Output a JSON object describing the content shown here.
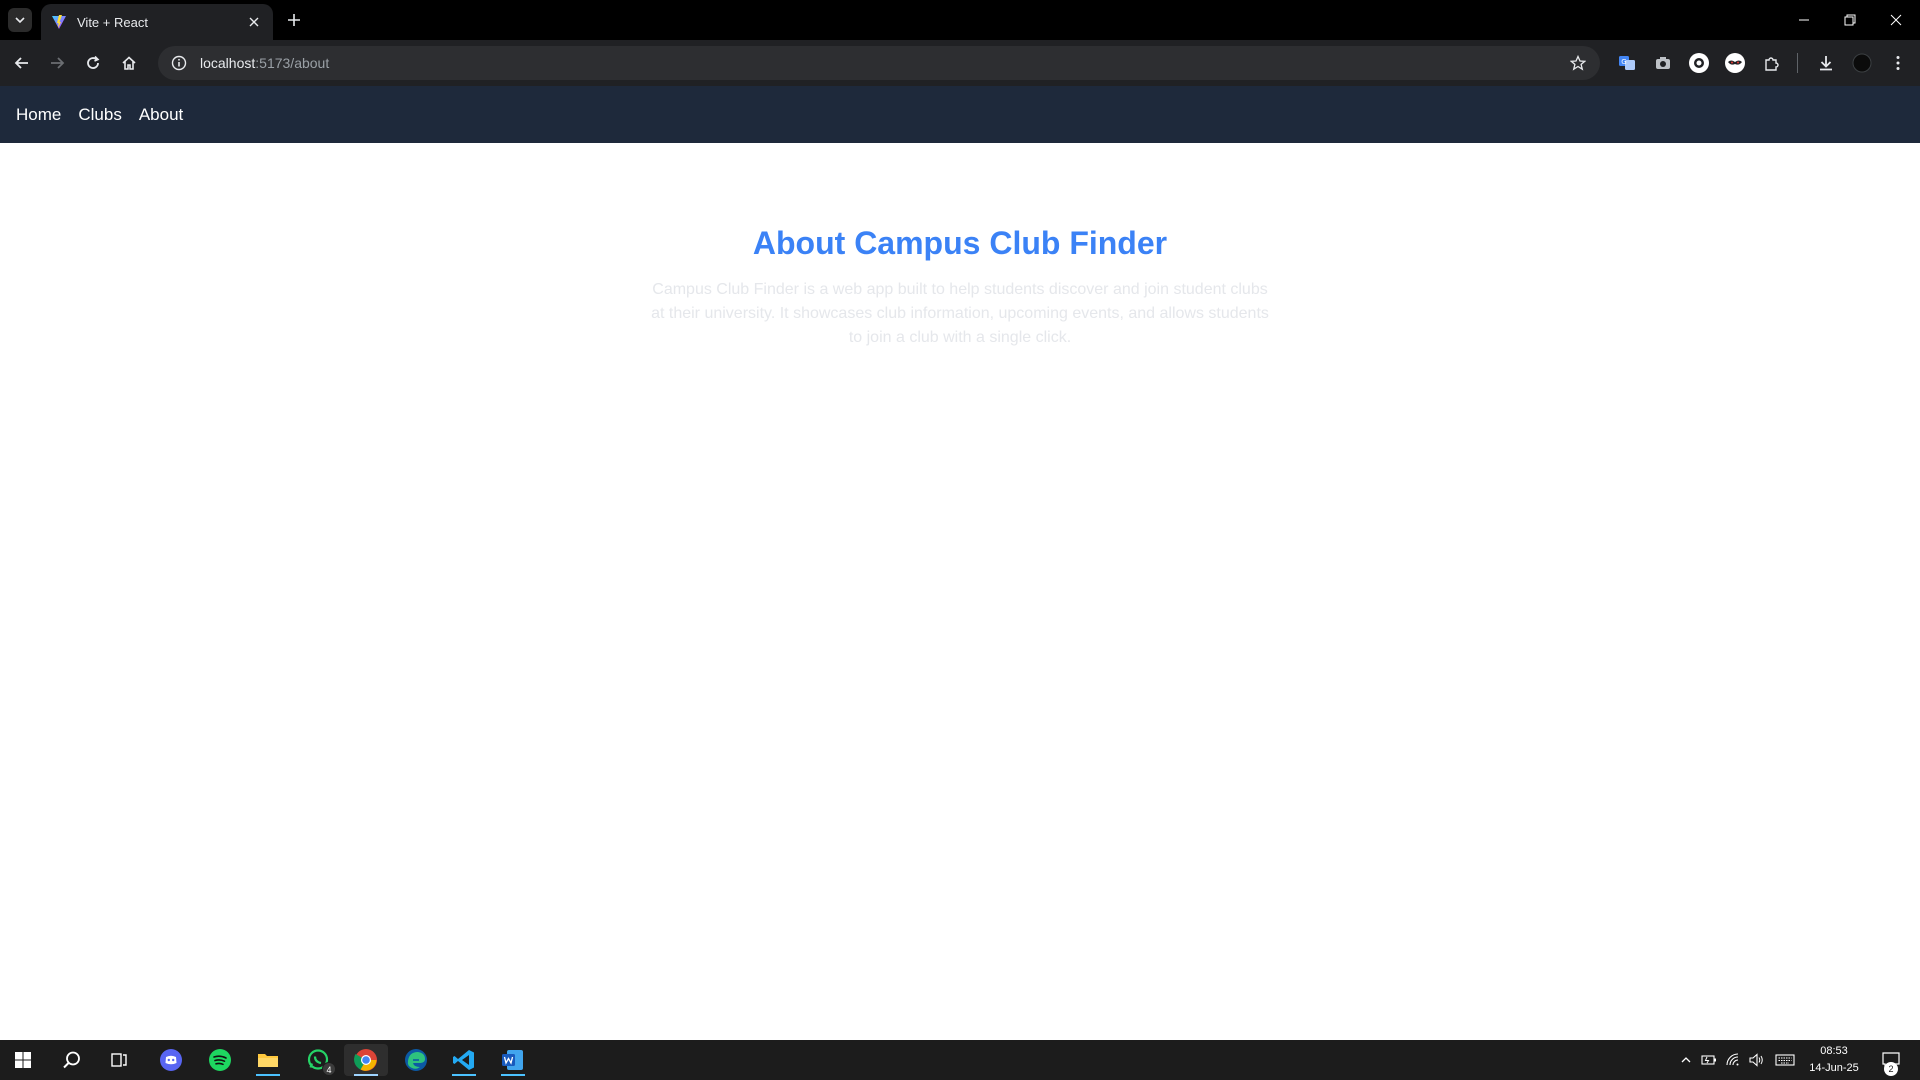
{
  "browser": {
    "tab_title": "Vite + React",
    "url_host": "localhost",
    "url_path": ":5173/about"
  },
  "site_nav": {
    "links": [
      "Home",
      "Clubs",
      "About"
    ]
  },
  "about": {
    "title": "About Campus Club Finder",
    "description": "Campus Club Finder is a web app built to help students discover and join student clubs at their university. It showcases club information, upcoming events, and allows students to join a club with a single click."
  },
  "taskbar": {
    "whatsapp_badge": "4",
    "time": "08:53",
    "date": "14-Jun-25",
    "notification_count": "2"
  },
  "colors": {
    "nav_bg": "#1e293b",
    "title_accent": "#3b82f6",
    "description_text": "#e5e7eb"
  }
}
